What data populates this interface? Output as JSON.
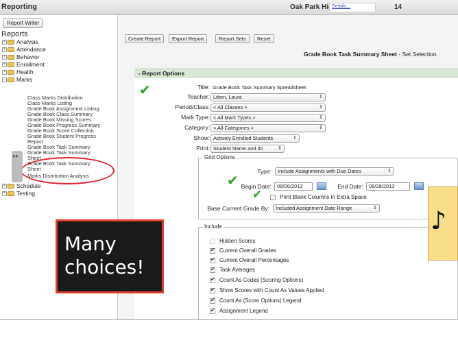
{
  "topbar": {
    "title": "Reporting",
    "school": "Oak Park Hig",
    "details": "Details...",
    "year": "14"
  },
  "left": {
    "report_writer": "Report Writer",
    "reports_heading": "Reports",
    "tree": [
      "Analysis",
      "Attendance",
      "Behavior",
      "Enrollment",
      "Health",
      "Marks"
    ],
    "marks_items": [
      "Class Marks Distribution",
      "Class Marks Listing",
      "Grade Book Assignment Listing",
      "Grade Book Class Summary",
      "Grade Book Missing Scores",
      "Grade Book Progress Summary",
      "Grade Book Score Collection",
      "Grade Book Student Progress",
      "Report",
      "Grade Book Task Summary",
      "Grade Book Task Summary",
      "Sheet",
      "Grade Book Task Summary",
      "Sheet",
      "Marks Distribution Analysis"
    ],
    "tree_after": [
      "Schedule",
      "Testing"
    ]
  },
  "overlay": {
    "text": "Many\nchoices!"
  },
  "toolbar": {
    "create": "Create Report",
    "export": "Export Report",
    "sets": "Report Sets",
    "reset": "Reset"
  },
  "page": {
    "title": "Grade Book Task Summary Sheet",
    "subtitle": "- Set Selection"
  },
  "section": {
    "title": "- Report Options"
  },
  "form": {
    "title_label": "Title:",
    "title_value": "Grade Book Task Summary Spreadsheet",
    "teacher_label": "Teacher:",
    "teacher_value": "Litten, Laura",
    "period_label": "Period/Class:",
    "period_value": "< All Classes >",
    "marktype_label": "Mark Type:",
    "marktype_value": "< All Mark Types >",
    "category_label": "Category:",
    "category_value": "< All Categories >",
    "show_label": "Show:",
    "show_value": "Actively Enrolled Students",
    "print_label": "Print:",
    "print_value": "Student Name and ID"
  },
  "grid": {
    "legend": "Grid Options",
    "type_label": "Type:",
    "type_value": "Include Assignments with Due Dates",
    "begin_label": "Begin Date:",
    "begin_value": "08/26/2013",
    "end_label": "End Date:",
    "end_value": "08/28/2013",
    "blank_label": "Print Blank Columns in Extra Space",
    "base_label": "Base Current Grade By:",
    "base_value": "Included Assignment Date Range"
  },
  "include": {
    "legend": "Include",
    "items": [
      {
        "label": "Hidden Scores",
        "checked": false
      },
      {
        "label": "Current Overall Grades",
        "checked": true
      },
      {
        "label": "Current Overall Percentages",
        "checked": true
      },
      {
        "label": "Task Averages",
        "checked": true
      },
      {
        "label": "Count As Codes (Scoring Options)",
        "checked": true
      },
      {
        "label": "Show Scores with Count As Values Applied",
        "checked": true
      },
      {
        "label": "Count As (Score Options) Legend",
        "checked": true
      },
      {
        "label": "Assignment Legend",
        "checked": true
      }
    ]
  },
  "colors": {
    "highlight_ring": "#e3202a",
    "checkmark": "#2e9e2c",
    "section_header": "#d9e8d5",
    "note": "#f9dd88"
  },
  "icons": [
    "checkmark-icon",
    "music-note-icon",
    "calendar-icon",
    "folder-icon"
  ]
}
